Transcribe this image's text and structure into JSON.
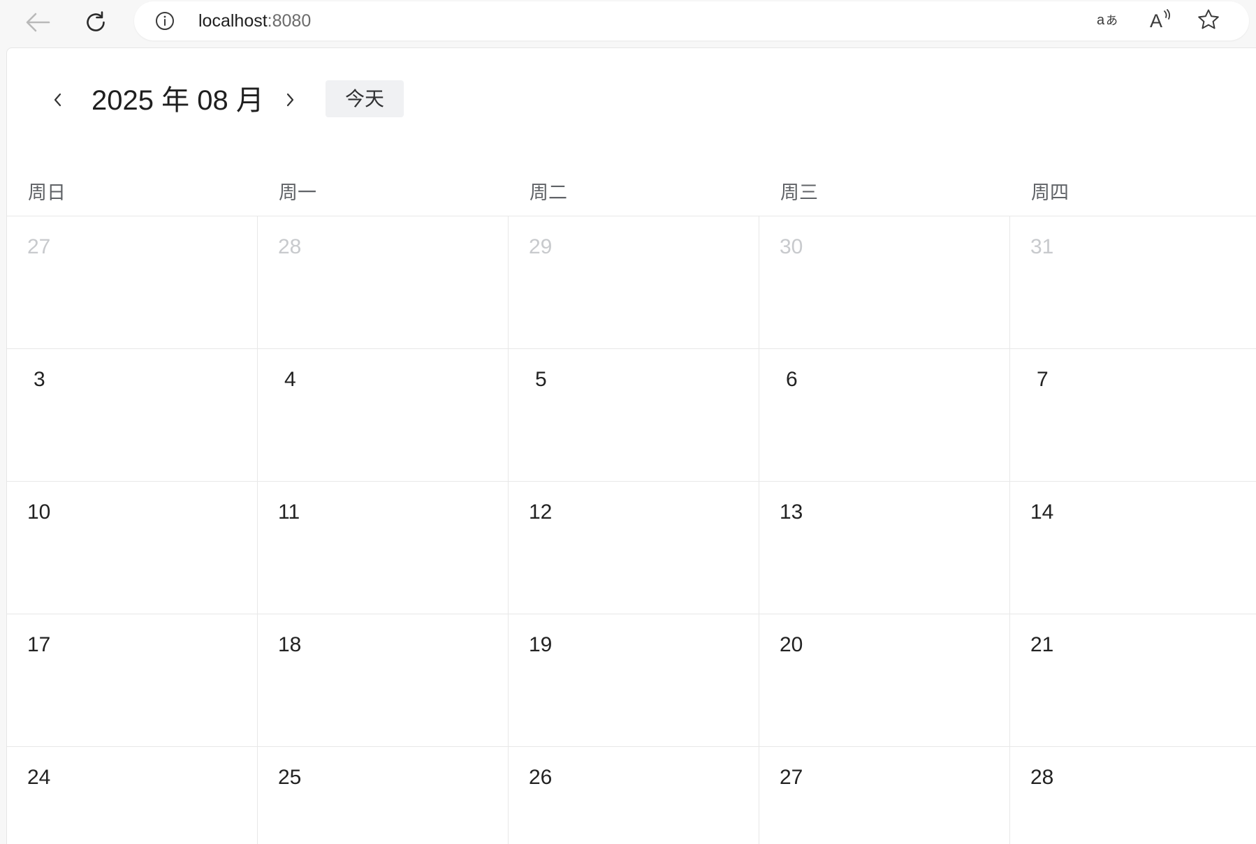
{
  "browser": {
    "url_host": "localhost",
    "url_port": ":8080",
    "icons": [
      "back-arrow-icon",
      "reload-icon",
      "info-icon",
      "translate-icon",
      "read-aloud-icon",
      "favorite-star-icon"
    ],
    "read_aloud_label": "A"
  },
  "calendar": {
    "title": "2025 年 08 月",
    "today_label": "今天",
    "weekdays": [
      "周日",
      "周一",
      "周二",
      "周三",
      "周四"
    ],
    "weeks": [
      [
        {
          "day": "27",
          "muted": true
        },
        {
          "day": "28",
          "muted": true
        },
        {
          "day": "29",
          "muted": true
        },
        {
          "day": "30",
          "muted": true
        },
        {
          "day": "31",
          "muted": true
        }
      ],
      [
        {
          "day": "3",
          "muted": false
        },
        {
          "day": "4",
          "muted": false
        },
        {
          "day": "5",
          "muted": false
        },
        {
          "day": "6",
          "muted": false
        },
        {
          "day": "7",
          "muted": false
        }
      ],
      [
        {
          "day": "10",
          "muted": false
        },
        {
          "day": "11",
          "muted": false
        },
        {
          "day": "12",
          "muted": false
        },
        {
          "day": "13",
          "muted": false
        },
        {
          "day": "14",
          "muted": false
        }
      ],
      [
        {
          "day": "17",
          "muted": false
        },
        {
          "day": "18",
          "muted": false
        },
        {
          "day": "19",
          "muted": false
        },
        {
          "day": "20",
          "muted": false
        },
        {
          "day": "21",
          "muted": false
        }
      ],
      [
        {
          "day": "24",
          "muted": false
        },
        {
          "day": "25",
          "muted": false
        },
        {
          "day": "26",
          "muted": false
        },
        {
          "day": "27",
          "muted": false
        },
        {
          "day": "28",
          "muted": false
        }
      ]
    ]
  },
  "colors": {
    "text": "#222222",
    "muted_text": "#c8cacd",
    "weekday_text": "#5f6266",
    "grid_line": "#e8e8e8",
    "today_button_bg": "#f0f1f3"
  }
}
